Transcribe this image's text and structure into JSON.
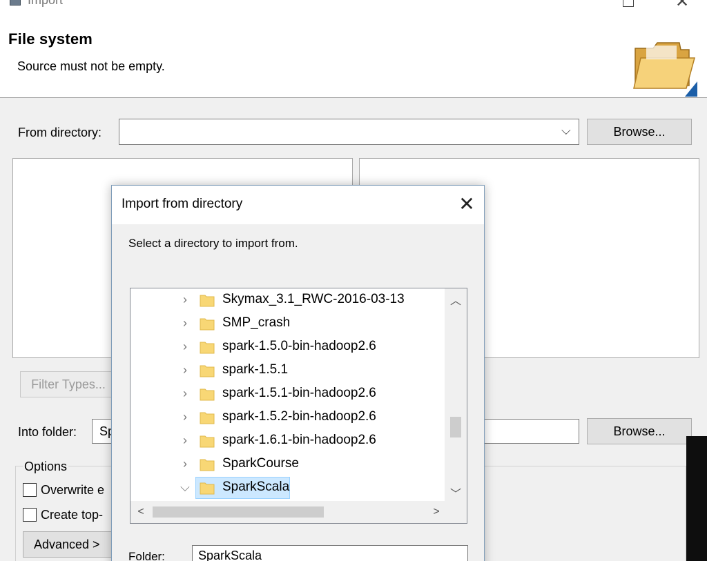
{
  "window": {
    "title": "Import"
  },
  "header": {
    "title": "File system",
    "message": "Source must not be empty."
  },
  "main": {
    "from_directory_label": "From directory:",
    "from_directory_value": "",
    "browse_label": "Browse...",
    "filter_types_label": "Filter Types...",
    "into_folder_label": "Into folder:",
    "into_folder_value": "Sp",
    "into_browse_label": "Browse...",
    "options_label": "Options",
    "overwrite_label": "Overwrite e",
    "create_top_label": "Create top-",
    "advanced_label": "Advanced >"
  },
  "dialog": {
    "title": "Import from directory",
    "instruction": "Select a directory to import from.",
    "close_glyph": "✕",
    "tree_items": [
      {
        "label": "Skymax_3.1_RWC-2016-03-13",
        "expanded": false,
        "selected": false
      },
      {
        "label": "SMP_crash",
        "expanded": false,
        "selected": false
      },
      {
        "label": "spark-1.5.0-bin-hadoop2.6",
        "expanded": false,
        "selected": false
      },
      {
        "label": "spark-1.5.1",
        "expanded": false,
        "selected": false
      },
      {
        "label": "spark-1.5.1-bin-hadoop2.6",
        "expanded": false,
        "selected": false
      },
      {
        "label": "spark-1.5.2-bin-hadoop2.6",
        "expanded": false,
        "selected": false
      },
      {
        "label": "spark-1.6.1-bin-hadoop2.6",
        "expanded": false,
        "selected": false
      },
      {
        "label": "SparkCourse",
        "expanded": false,
        "selected": false
      },
      {
        "label": "SparkScala",
        "expanded": true,
        "selected": true
      }
    ],
    "folder_label": "Folder:",
    "folder_value": "SparkScala"
  },
  "colors": {
    "folder_yellow": "#f8d775",
    "selection": "#cce8ff"
  }
}
